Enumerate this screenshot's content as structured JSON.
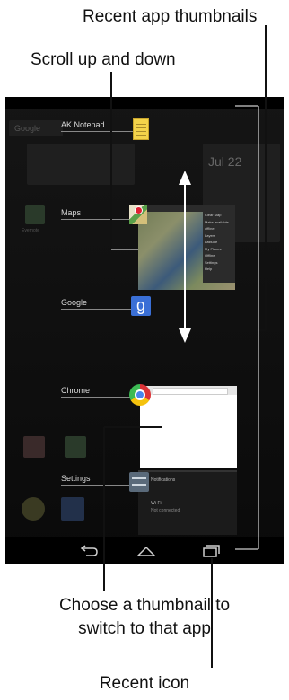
{
  "callouts": {
    "recent_thumbnails": "Recent app thumbnails",
    "scroll": "Scroll up and down",
    "choose_line1": "Choose a thumbnail to",
    "choose_line2": "switch to that app",
    "recent_icon": "Recent icon"
  },
  "recent_apps": [
    {
      "label": "AK Notepad",
      "icon": "notepad-icon"
    },
    {
      "label": "Maps",
      "icon": "maps-icon"
    },
    {
      "label": "Google",
      "icon": "google-icon"
    },
    {
      "label": "Chrome",
      "icon": "chrome-icon"
    },
    {
      "label": "Settings",
      "icon": "settings-icon"
    }
  ],
  "google_letter": "g",
  "maps_menu": [
    "Clear Map",
    "Make available offline",
    "Layers",
    "Latitude",
    "My Places",
    "Offline",
    "Settings",
    "Help"
  ],
  "settings_items": [
    "Notifications",
    "Wi-Fi",
    "Not connected"
  ],
  "background_widgets": {
    "date": "Jul 22",
    "search": "Google",
    "evernote": "Evernote"
  },
  "nav": {
    "back_icon": "back-icon",
    "home_icon": "home-icon",
    "recent_icon": "recent-apps-icon"
  },
  "colors": {
    "google_blue": "#3a6fd6",
    "notepad_yellow": "#f3d34a",
    "phone_bg": "#0c0c0c"
  }
}
